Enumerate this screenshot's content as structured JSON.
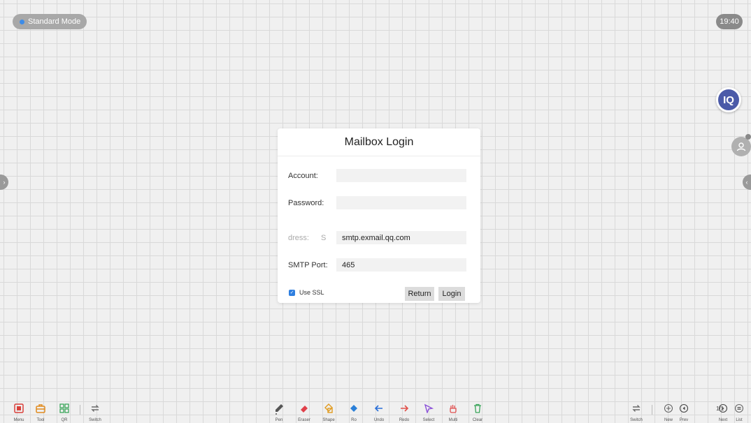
{
  "status": {
    "mode_label": "Standard Mode",
    "clock": "19:40"
  },
  "side": {
    "iq_label": "IQ",
    "user_icon": "user-icon"
  },
  "dialog": {
    "title": "Mailbox Login",
    "account_label": "Account:",
    "account_value": "",
    "password_label": "Password:",
    "password_value": "",
    "smtp_address_label": "dress:",
    "smtp_address_label_faded": "S",
    "smtp_address_value": "smtp.exmail.qq.com",
    "smtp_port_label": "SMTP Port:",
    "smtp_port_value": "465",
    "use_ssl_label": "Use SSL",
    "use_ssl_checked": true,
    "return_button": "Return",
    "login_button": "Login"
  },
  "toolbar_left": [
    {
      "label": "Menu",
      "icon": "menu-icon",
      "color": "#d9403a"
    },
    {
      "label": "Tool",
      "icon": "toolbox-icon",
      "color": "#e08a1e"
    },
    {
      "label": "QR",
      "icon": "qr-icon",
      "color": "#3aa55a"
    },
    {
      "label": "Switch",
      "icon": "switch-icon",
      "color": "#6a6a6a"
    }
  ],
  "toolbar_center": [
    {
      "label": "Pen",
      "icon": "pen-icon",
      "color": "#555555"
    },
    {
      "label": "Eraser",
      "icon": "eraser-icon",
      "color": "#e0404a"
    },
    {
      "label": "Shape",
      "icon": "shape-icon",
      "color": "#e09a1e"
    },
    {
      "label": "Ro",
      "icon": "roaming-icon",
      "color": "#2a7fd8"
    },
    {
      "label": "Undo",
      "icon": "undo-icon",
      "color": "#2a6fd8"
    },
    {
      "label": "Redo",
      "icon": "redo-icon",
      "color": "#e0504a"
    },
    {
      "label": "Select",
      "icon": "select-icon",
      "color": "#8a4fd8"
    },
    {
      "label": "Multi",
      "icon": "multi-touch-icon",
      "color": "#e05050"
    },
    {
      "label": "Clear",
      "icon": "clear-icon",
      "color": "#3aa55a"
    }
  ],
  "toolbar_right": [
    {
      "label": "Switch",
      "icon": "switch-icon"
    },
    {
      "label": "New",
      "icon": "new-page-icon"
    },
    {
      "label": "Prev",
      "icon": "prev-page-icon"
    },
    {
      "label": "Next",
      "icon": "next-page-icon"
    },
    {
      "label": "List",
      "icon": "list-icon"
    }
  ],
  "page_counter": "1/1"
}
